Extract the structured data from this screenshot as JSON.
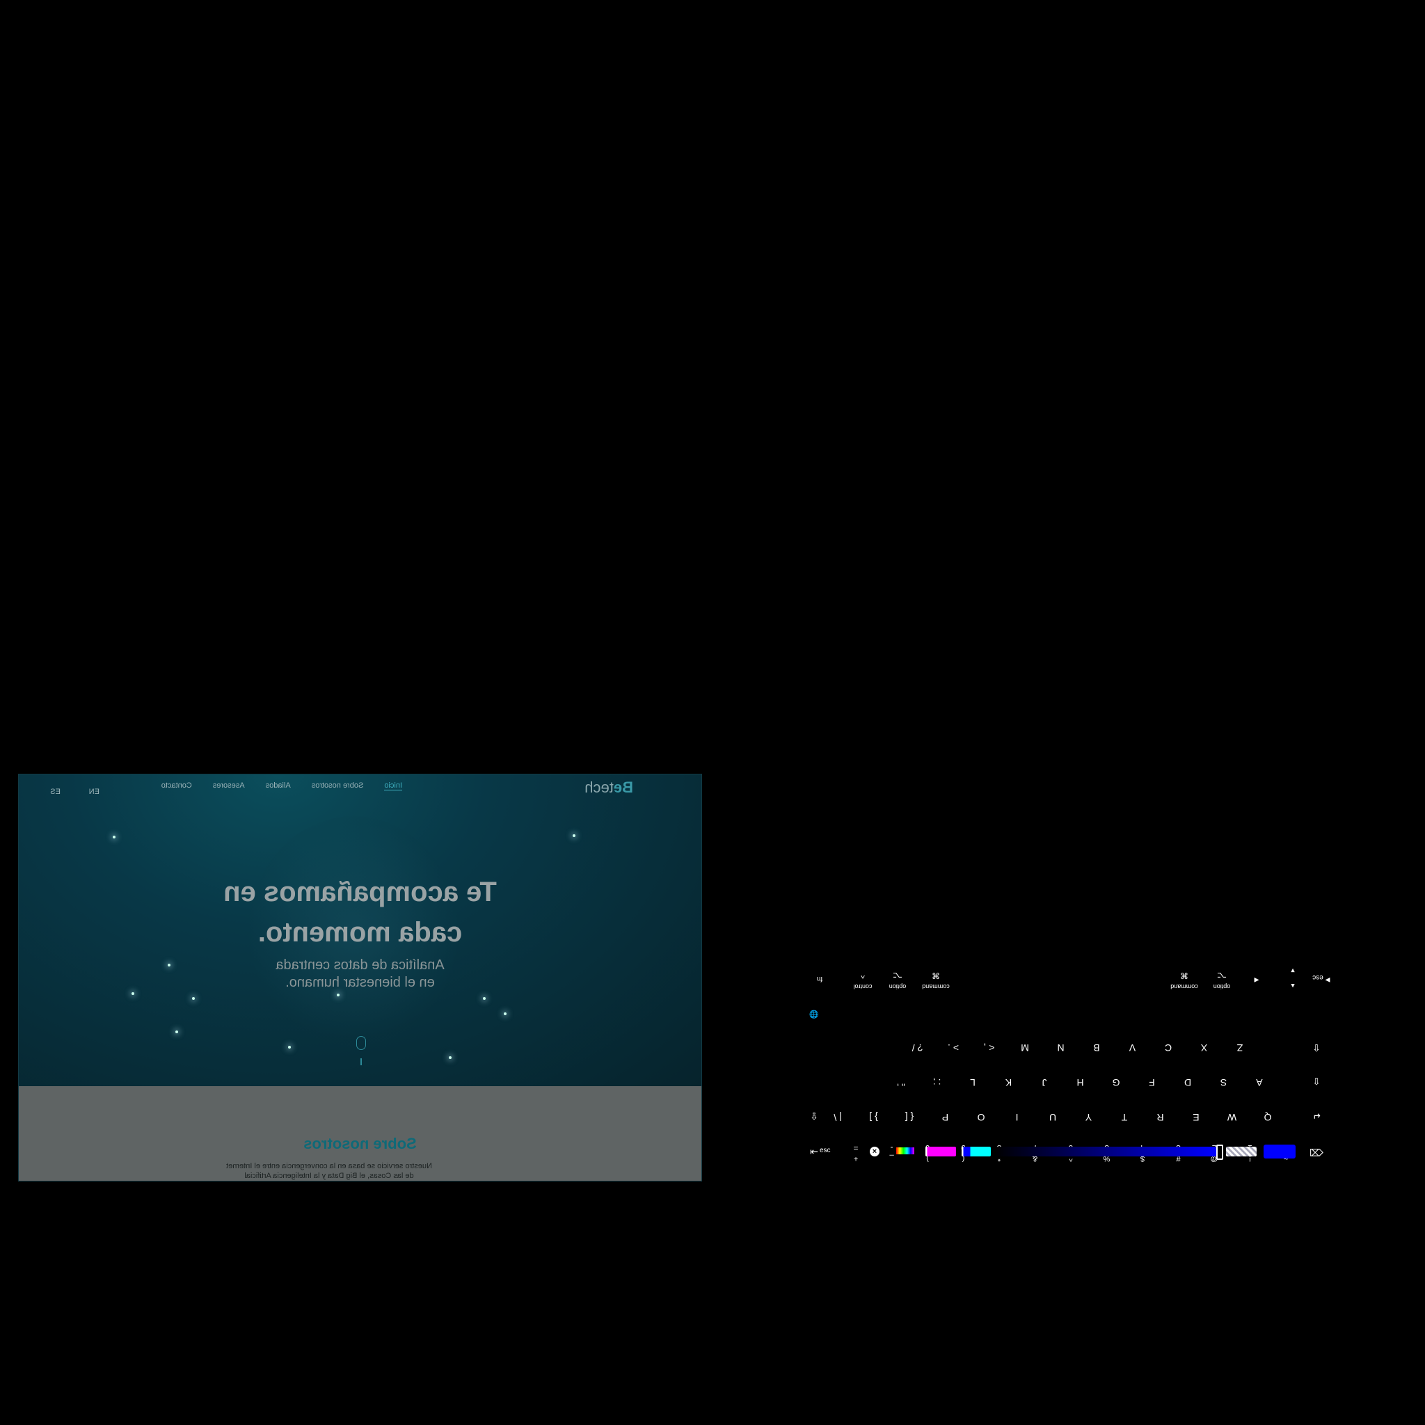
{
  "website": {
    "logo": {
      "brand": "Be",
      "suffix": "tech"
    },
    "nav": [
      "Inicio",
      "Sobre nosotros",
      "Aliados",
      "Asesores",
      "Contacto"
    ],
    "active_nav": "Inicio",
    "languages": [
      "EN",
      "ES"
    ],
    "hero": {
      "title_line1": "Te acompañamos en",
      "title_line2": "cada momento.",
      "subtitle_line1": "Analítica de datos centrada",
      "subtitle_line2": "en el bienestar humano."
    },
    "about": {
      "title": "Sobre nosotros",
      "text": "Nuestro servicio se basa en la convergencia entre el Internet de las Cosas, el Big Data y la Inteligencia Artificial"
    }
  },
  "keyboard": {
    "colors": {
      "accent": "#0000ff",
      "magenta": "#ff00ff",
      "cyan": "#00ffff"
    },
    "row_numbers": [
      {
        "top": "~",
        "bot": "`"
      },
      {
        "top": "!",
        "bot": "1"
      },
      {
        "top": "@",
        "bot": "2"
      },
      {
        "top": "#",
        "bot": "3"
      },
      {
        "top": "$",
        "bot": "4"
      },
      {
        "top": "%",
        "bot": "5"
      },
      {
        "top": "^",
        "bot": "6"
      },
      {
        "top": "&",
        "bot": "7"
      },
      {
        "top": "*",
        "bot": "8"
      },
      {
        "top": "(",
        "bot": "9"
      },
      {
        "top": ")",
        "bot": "0"
      },
      {
        "top": "_",
        "bot": "-"
      },
      {
        "top": "+",
        "bot": "="
      }
    ],
    "row_q": [
      "Q",
      "W",
      "E",
      "R",
      "T",
      "Y",
      "U",
      "I",
      "O",
      "P",
      "{ [",
      "} ]",
      "| \\"
    ],
    "row_a": [
      "A",
      "S",
      "D",
      "F",
      "G",
      "H",
      "J",
      "K",
      "L",
      ": ;",
      "\" '"
    ],
    "row_z": [
      "Z",
      "X",
      "C",
      "V",
      "B",
      "N",
      "M",
      "< ,",
      "> .",
      "? /"
    ],
    "mods": {
      "esc": "esc",
      "fn": "fn",
      "control": "control",
      "option": "option",
      "command": "command",
      "control_sym": "^",
      "option_sym": "⌥",
      "command_sym": "⌘",
      "tab": "⇥",
      "caps": "⇪",
      "shift": "⇧",
      "return": "↵",
      "delete": "⌫",
      "globe": "🌐",
      "arrow_left": "◀",
      "arrow_right": "▶",
      "arrow_up": "▲",
      "arrow_down": "▼"
    },
    "close": "×"
  }
}
